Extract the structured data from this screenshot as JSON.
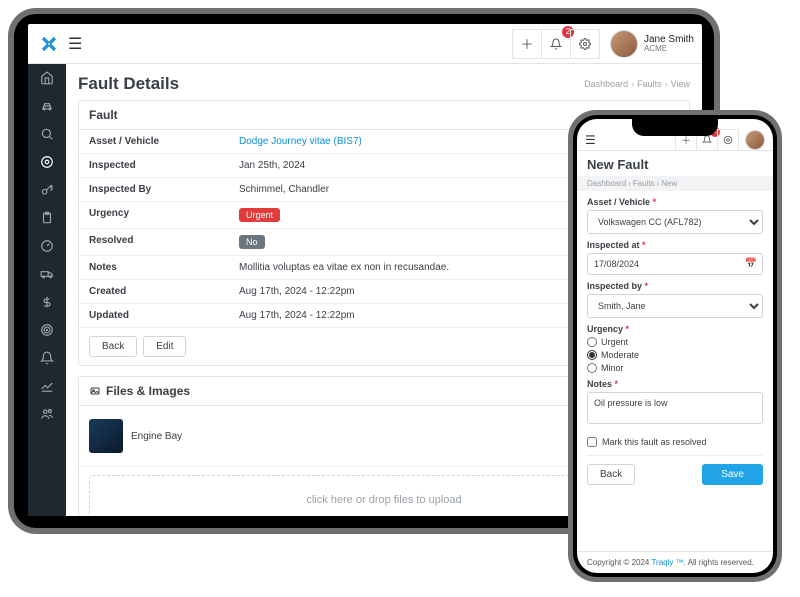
{
  "tablet": {
    "user": {
      "name": "Jane Smith",
      "org": "ACME"
    },
    "notif_count": "2",
    "page_title": "Fault Details",
    "crumbs": {
      "a": "Dashboard",
      "b": "Faults",
      "c": "View"
    },
    "card1_title": "Fault",
    "rows": {
      "asset_k": "Asset / Vehicle",
      "asset_v": "Dodge Journey vitae (BIS7)",
      "inspected_k": "Inspected",
      "inspected_v": "Jan 25th, 2024",
      "inspectedby_k": "Inspected By",
      "inspectedby_v": "Schimmel, Chandler",
      "urgency_k": "Urgency",
      "urgency_v": "Urgent",
      "resolved_k": "Resolved",
      "resolved_v": "No",
      "notes_k": "Notes",
      "notes_v": "Mollitia voluptas ea vitae ex non in recusandae.",
      "created_k": "Created",
      "created_v": "Aug 17th, 2024 - 12:22pm",
      "updated_k": "Updated",
      "updated_v": "Aug 17th, 2024 - 12:22pm"
    },
    "btns": {
      "back": "Back",
      "edit": "Edit"
    },
    "files": {
      "title": "Files & Images",
      "item1_name": "Engine Bay",
      "drop": "click here or drop files to upload"
    }
  },
  "phone": {
    "notif_count": "2",
    "page_title": "New Fault",
    "crumbs": {
      "a": "Dashboard",
      "b": "Faults",
      "c": "New"
    },
    "form": {
      "asset_lbl": "Asset / Vehicle",
      "asset_val": "Volkswagen CC (AFL782)",
      "inspectedat_lbl": "Inspected at",
      "inspectedat_val": "17/08/2024",
      "inspectedby_lbl": "Inspected by",
      "inspectedby_val": "Smith, Jane",
      "urgency_lbl": "Urgency",
      "urgency_opts": {
        "urgent": "Urgent",
        "moderate": "Moderate",
        "minor": "Minor"
      },
      "notes_lbl": "Notes",
      "notes_val": "Oil pressure is low",
      "resolved_lbl": "Mark this fault as resolved",
      "back": "Back",
      "save": "Save"
    },
    "footer": {
      "pre": "Copyright © 2024 ",
      "brand": "Traqly ™",
      "post": ". All rights reserved."
    }
  }
}
